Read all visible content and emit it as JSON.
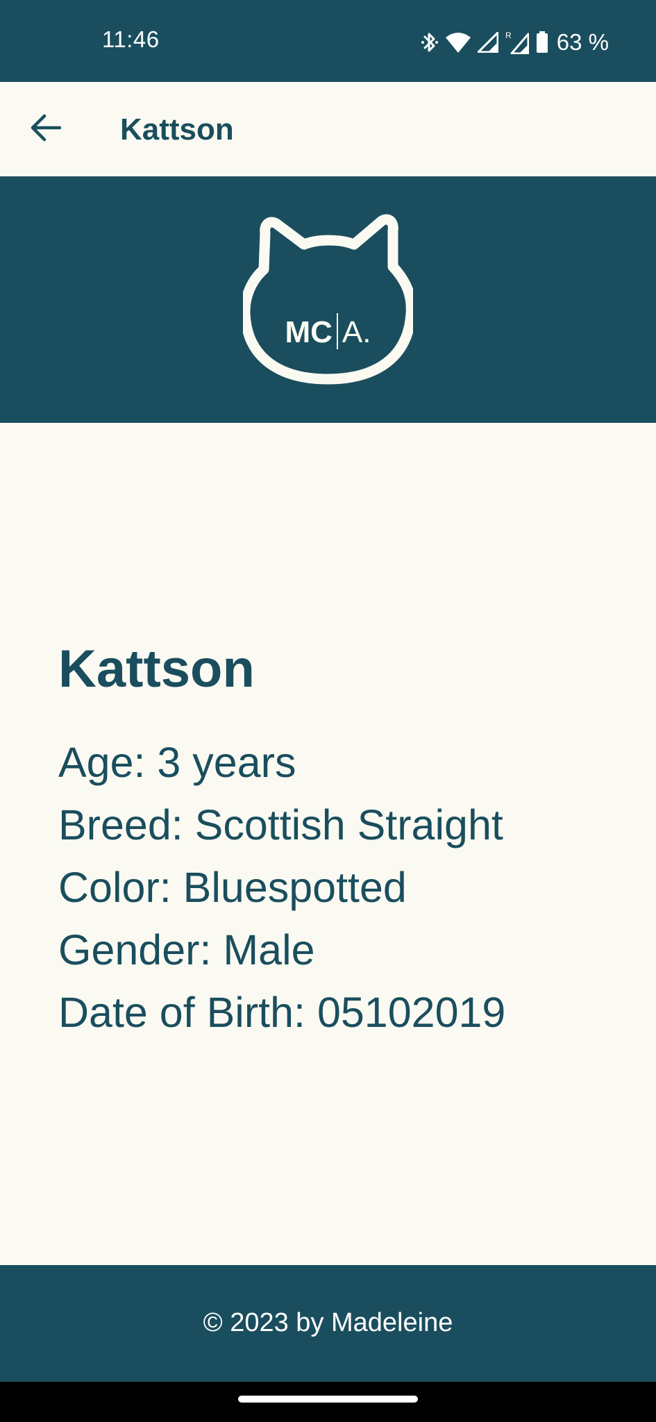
{
  "status_bar": {
    "time": "11:46",
    "battery": "63 %",
    "icons": [
      "bluetooth-icon",
      "wifi-icon",
      "signal-icon",
      "signal-roaming-icon",
      "battery-icon"
    ],
    "roaming_label": "R"
  },
  "app_bar": {
    "title": "Kattson",
    "back_icon": "arrow-left-icon"
  },
  "logo": {
    "mc": "MC",
    "a": "A."
  },
  "cat": {
    "name": "Kattson",
    "age": "Age: 3 years",
    "breed": "Breed: Scottish Straight",
    "color": "Color: Bluespotted",
    "gender": "Gender: Male",
    "dob": "Date of Birth: 05102019"
  },
  "footer": {
    "text": "© 2023 by Madeleine"
  },
  "colors": {
    "primary": "#1a4e5e",
    "background": "#fbfaf2",
    "on_primary": "#ffffff"
  }
}
